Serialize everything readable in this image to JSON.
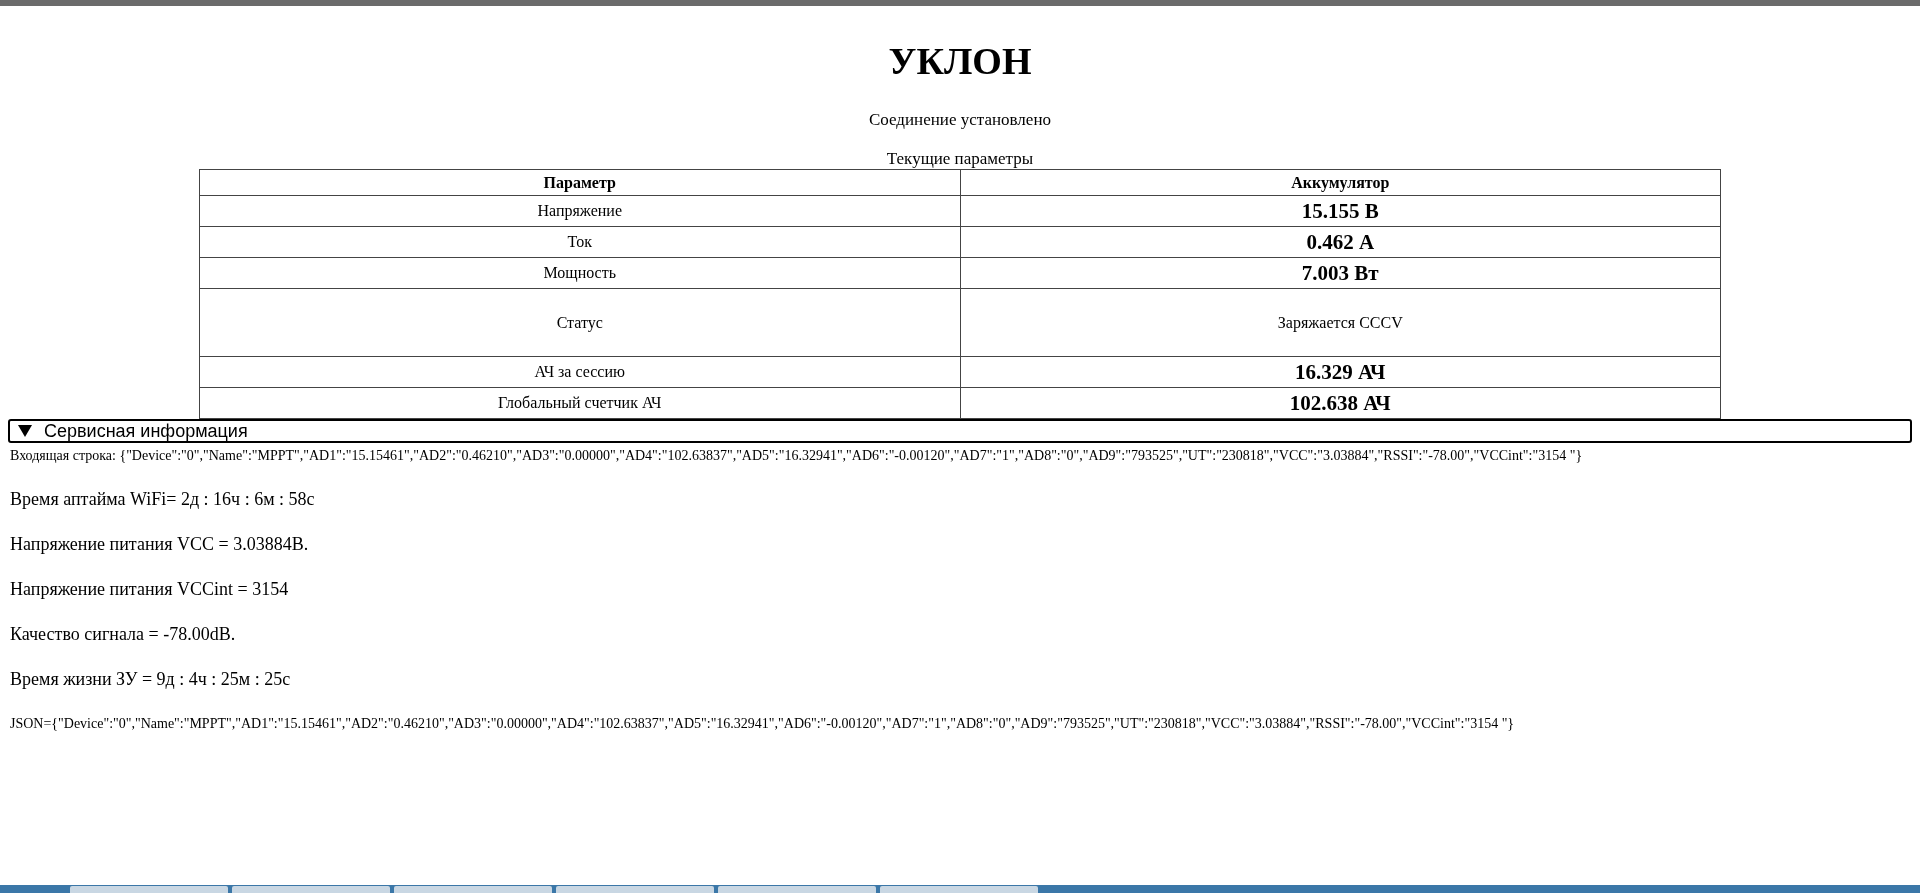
{
  "title": "УКЛОН",
  "connection_status": "Соединение установлено",
  "table": {
    "caption": "Текущие параметры",
    "columns": [
      "Параметр",
      "Аккумулятор"
    ],
    "rows": [
      {
        "kind": "value",
        "name": "Напряжение",
        "value": "15.155 В"
      },
      {
        "kind": "value",
        "name": "Ток",
        "value": "0.462 А"
      },
      {
        "kind": "value",
        "name": "Мощность",
        "value": "7.003 Вт"
      },
      {
        "kind": "text",
        "name": "Статус",
        "value": "Заряжается CCCV"
      },
      {
        "kind": "value",
        "name": "АЧ за сессию",
        "value": "16.329 АЧ"
      },
      {
        "kind": "value",
        "name": "Глобальный счетчик АЧ",
        "value": "102.638 АЧ"
      }
    ]
  },
  "service_info": {
    "summary": "Сервисная информация",
    "expanded": true,
    "input_line": "Входящая строка: {\"Device\":\"0\",\"Name\":\"MPPT\",\"AD1\":\"15.15461\",\"AD2\":\"0.46210\",\"AD3\":\"0.00000\",\"AD4\":\"102.63837\",\"AD5\":\"16.32941\",\"AD6\":\"-0.00120\",\"AD7\":\"1\",\"AD8\":\"0\",\"AD9\":\"793525\",\"UT\":\"230818\",\"VCC\":\"3.03884\",\"RSSI\":\"-78.00\",\"VCCint\":\"3154 \"}",
    "lines": [
      "Время аптайма WiFi= 2д : 16ч : 6м : 58с",
      "Напряжение питания VCC = 3.03884В.",
      "Напряжение питания VCCint = 3154",
      "Качество сигнала = -78.00dB.",
      "Время жизни ЗУ = 9д : 4ч : 25м : 25с"
    ],
    "json_line": "JSON={\"Device\":\"0\",\"Name\":\"MPPT\",\"AD1\":\"15.15461\",\"AD2\":\"0.46210\",\"AD3\":\"0.00000\",\"AD4\":\"102.63837\",\"AD5\":\"16.32941\",\"AD6\":\"-0.00120\",\"AD7\":\"1\",\"AD8\":\"0\",\"AD9\":\"793525\",\"UT\":\"230818\",\"VCC\":\"3.03884\",\"RSSI\":\"-78.00\",\"VCCint\":\"3154 \"}"
  }
}
